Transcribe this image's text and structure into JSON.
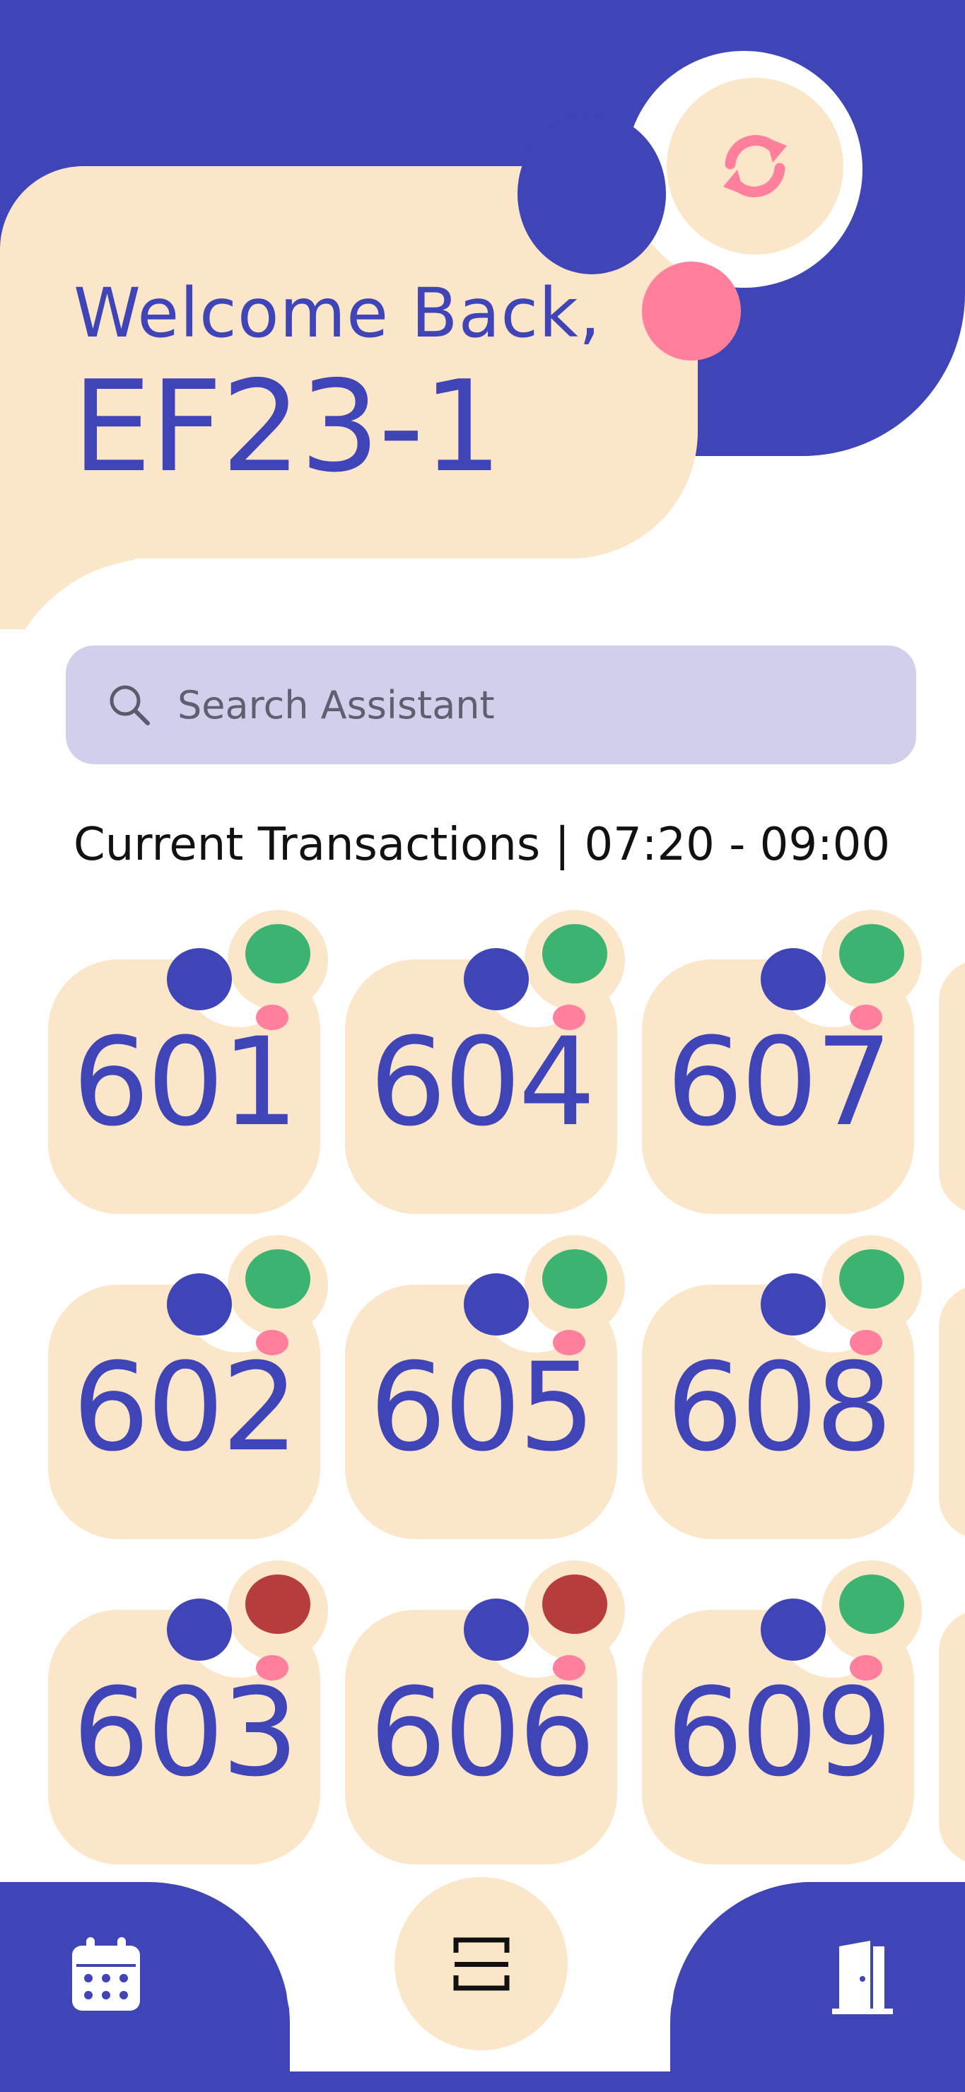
{
  "header": {
    "welcome": "Welcome Back,",
    "username": "EF23-1"
  },
  "search": {
    "placeholder": "Search Assistant"
  },
  "transactions": {
    "heading": "Current Transactions | 07:20 - 09:00"
  },
  "rooms": [
    {
      "number": "601",
      "status": "available"
    },
    {
      "number": "604",
      "status": "available"
    },
    {
      "number": "607",
      "status": "available"
    },
    {
      "number": "602",
      "status": "available"
    },
    {
      "number": "605",
      "status": "available"
    },
    {
      "number": "608",
      "status": "available"
    },
    {
      "number": "603",
      "status": "occupied"
    },
    {
      "number": "606",
      "status": "occupied"
    },
    {
      "number": "609",
      "status": "available"
    }
  ],
  "colors": {
    "primary": "#3F44B7",
    "cream": "#FCE6C9",
    "pink": "#FF7F9C",
    "available": "#3CB371",
    "occupied": "#B53D3D",
    "search_bg": "#D0D0EC"
  },
  "icons": {
    "refresh": "refresh-icon",
    "search": "search-icon",
    "calendar": "calendar-icon",
    "scan": "scan-icon",
    "exit": "door-exit-icon"
  }
}
